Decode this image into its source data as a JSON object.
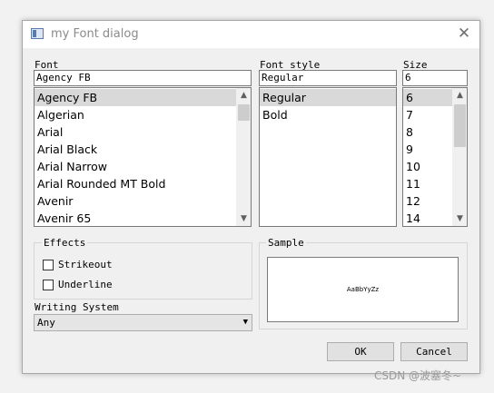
{
  "window": {
    "title": "my Font dialog",
    "close_glyph": "✕"
  },
  "font": {
    "label": "Font",
    "value": "Agency FB",
    "items": [
      "Agency FB",
      "Algerian",
      "Arial",
      "Arial Black",
      "Arial Narrow",
      "Arial Rounded MT Bold",
      "Avenir",
      "Avenir 65"
    ],
    "selected": "Agency FB"
  },
  "style": {
    "label": "Font style",
    "value": "Regular",
    "items": [
      "Regular",
      "Bold"
    ],
    "selected": "Regular"
  },
  "size": {
    "label": "Size",
    "value": "6",
    "items": [
      "6",
      "7",
      "8",
      "9",
      "10",
      "11",
      "12",
      "14"
    ],
    "selected": "6"
  },
  "effects": {
    "title": "Effects",
    "strikeout": "Strikeout",
    "underline": "Underline"
  },
  "writing_system": {
    "label": "Writing System",
    "value": "Any"
  },
  "sample": {
    "title": "Sample",
    "text": "AaBbYyZz"
  },
  "buttons": {
    "ok": "OK",
    "cancel": "Cancel"
  },
  "watermark": "CSDN @波塞冬~"
}
